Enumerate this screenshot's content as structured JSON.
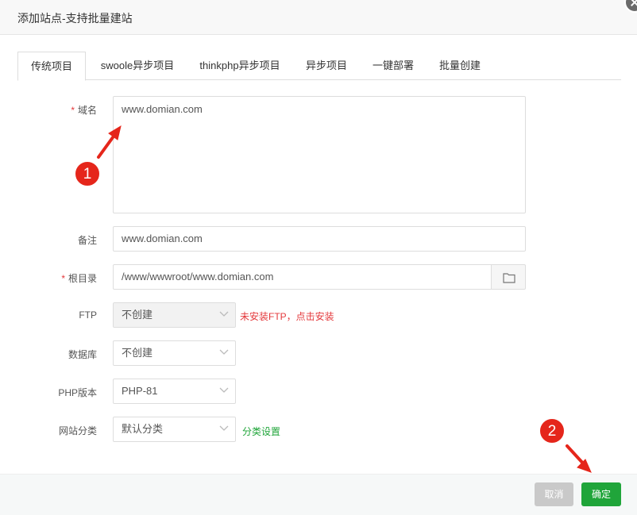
{
  "dialog": {
    "title": "添加站点-支持批量建站"
  },
  "tabs": [
    {
      "label": "传统项目",
      "active": true
    },
    {
      "label": "swoole异步项目"
    },
    {
      "label": "thinkphp异步项目"
    },
    {
      "label": "异步项目"
    },
    {
      "label": "一键部署"
    },
    {
      "label": "批量创建"
    }
  ],
  "form": {
    "required_mark": "*",
    "domain": {
      "label": "域名",
      "value": "www.domian.com"
    },
    "remark": {
      "label": "备注",
      "value": "www.domian.com"
    },
    "root": {
      "label": "根目录",
      "value": "/www/wwwroot/www.domian.com"
    },
    "ftp": {
      "label": "FTP",
      "value": "不创建",
      "hint": "未安装FTP，点击安装"
    },
    "database": {
      "label": "数据库",
      "value": "不创建"
    },
    "php": {
      "label": "PHP版本",
      "value": "PHP-81"
    },
    "category": {
      "label": "网站分类",
      "value": "默认分类",
      "link": "分类设置"
    }
  },
  "footer": {
    "cancel_label": "取消",
    "ok_label": "确定"
  },
  "annotations": {
    "badge1": "1",
    "badge2": "2"
  },
  "colors": {
    "accent_green": "#20a53a",
    "warning_red": "#e4393c",
    "annotation_red": "#e5261b"
  }
}
